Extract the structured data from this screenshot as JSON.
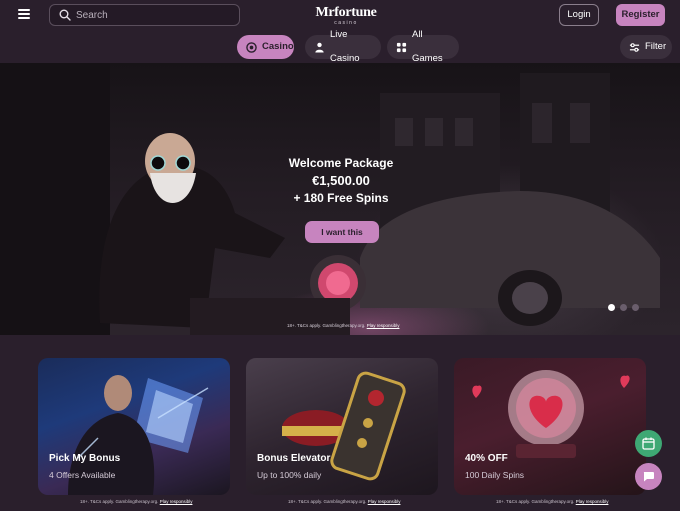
{
  "header": {
    "search_placeholder": "Search",
    "logo_text": "Mrfortune",
    "logo_sub": "casino",
    "login_label": "Login",
    "register_label": "Register"
  },
  "nav": {
    "tabs": [
      {
        "label": "Casino",
        "icon": "chip-icon",
        "active": true
      },
      {
        "label": "Live Casino",
        "icon": "dealer-icon",
        "active": false
      },
      {
        "label": "All Games",
        "icon": "grid-icon",
        "active": false
      }
    ],
    "filter_label": "Filter"
  },
  "hero": {
    "line1": "Welcome Package",
    "line2": "€1,500.00",
    "line3": "+ 180 Free Spins",
    "cta_label": "I want this",
    "legal_text": "18+. T&Cs apply. Gamblingtherapy.org.",
    "legal_link": "Play responsibly",
    "slides": 3,
    "active_slide": 1
  },
  "promos": [
    {
      "title": "Pick My Bonus",
      "subtitle": "4 Offers Available",
      "legal_text": "18+. T&Cs apply. Gamblingtherapy.org.",
      "legal_link": "Play responsibly"
    },
    {
      "title": "Bonus Elevator",
      "subtitle": "Up to 100% daily",
      "legal_text": "18+. T&Cs apply. Gamblingtherapy.org.",
      "legal_link": "Play responsibly"
    },
    {
      "title": "40% OFF",
      "subtitle": "100 Daily Spins",
      "legal_text": "18+. T&Cs apply. Gamblingtherapy.org.",
      "legal_link": "Play responsibly"
    }
  ],
  "colors": {
    "background": "#2a1f2c",
    "accent": "#c784bf",
    "calendar_fab": "#3ea874"
  }
}
